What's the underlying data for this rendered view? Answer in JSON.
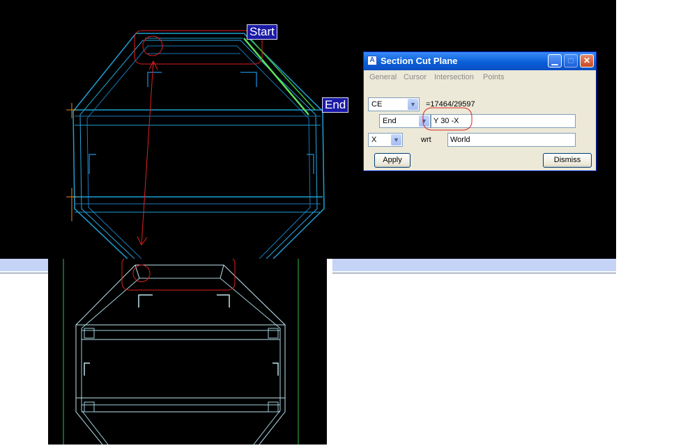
{
  "labels": {
    "start": "Start",
    "end": "End"
  },
  "dialog": {
    "title": "Section Cut Plane",
    "menu": [
      "General",
      "Cursor",
      "Intersection",
      "Points"
    ],
    "row1": {
      "select": "CE",
      "ref": "=17464/29597"
    },
    "row2": {
      "select": "End",
      "value": "Y 30 -X"
    },
    "row3": {
      "select": "X",
      "wrt_label": "wrt",
      "wrt_value": "World"
    },
    "apply_label": "Apply",
    "dismiss_label": "Dismiss"
  },
  "colors": {
    "cad_background": "#000000",
    "model_cyan": "#1e9fd6",
    "highlight_green": "#5be35b",
    "annotation_red": "#e02020",
    "label_blue": "#1a1aa6"
  }
}
